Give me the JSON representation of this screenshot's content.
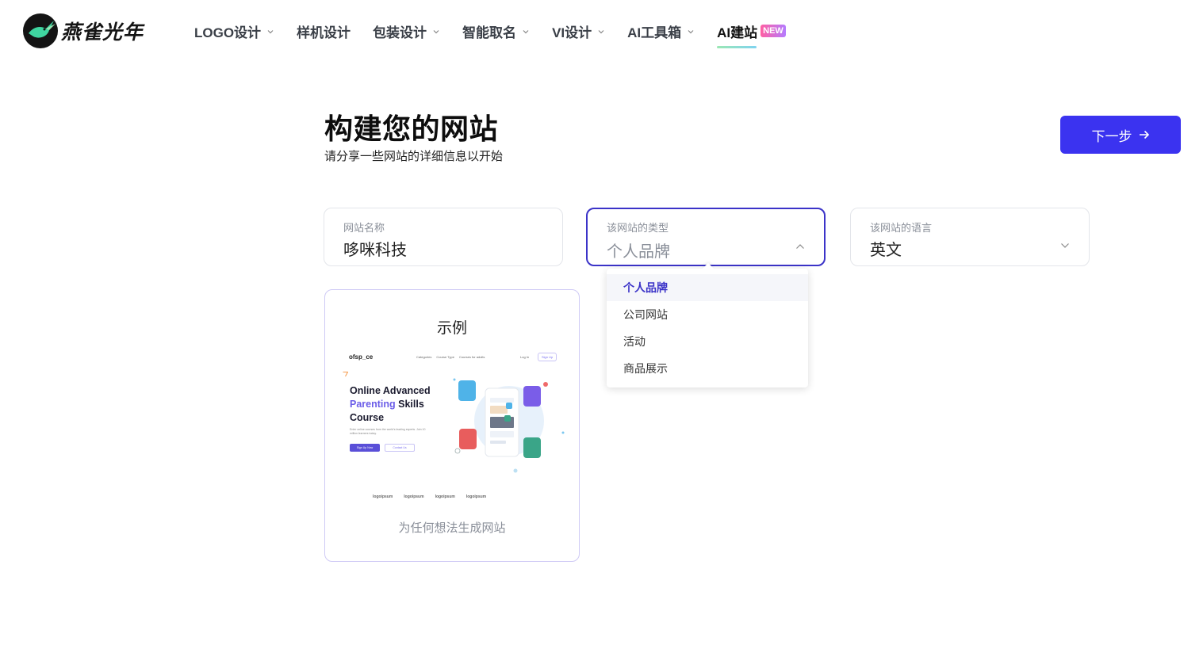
{
  "brand": {
    "name": "燕雀光年"
  },
  "nav": {
    "items": [
      {
        "label": "LOGO设计",
        "has_dropdown": true
      },
      {
        "label": "样机设计",
        "has_dropdown": false
      },
      {
        "label": "包装设计",
        "has_dropdown": true
      },
      {
        "label": "智能取名",
        "has_dropdown": true
      },
      {
        "label": "VI设计",
        "has_dropdown": true
      },
      {
        "label": "AI工具箱",
        "has_dropdown": true
      },
      {
        "label": "AI建站",
        "has_dropdown": false,
        "active": true,
        "badge": "NEW"
      }
    ]
  },
  "header": {
    "title": "构建您的网站",
    "subtitle": "请分享一些网站的详细信息以开始",
    "next_label": "下一步"
  },
  "form": {
    "name": {
      "label": "网站名称",
      "value": "哆咪科技"
    },
    "type": {
      "label": "该网站的类型",
      "value": "个人品牌"
    },
    "language": {
      "label": "该网站的语言",
      "value": "英文"
    }
  },
  "dropdown": {
    "options": [
      "个人品牌",
      "公司网站",
      "活动",
      "商品展示"
    ],
    "selected": "个人品牌"
  },
  "example": {
    "title": "示例",
    "caption": "为任何想法生成网站",
    "preview": {
      "logo": "ofsp_ce",
      "nav": [
        "Categories",
        "Course Type",
        "Courses for adults"
      ],
      "login": "Log In",
      "signup": "Sign Up",
      "headline_1": "Online Advanced",
      "headline_2a": "Parenting",
      "headline_2b": " Skills",
      "headline_3": "Course",
      "body": "Enter online courses from the world's leading experts. Join 10 million learners today.",
      "cta_primary": "Sign Up Now",
      "cta_secondary": "Contact Us",
      "partners": [
        "logoipsum",
        "logoipsum",
        "logoipsum",
        "logoipsum"
      ]
    }
  },
  "colors": {
    "primary": "#3b33f0",
    "focus_border": "#3b33c8",
    "accent_purple": "#6b5de8"
  }
}
